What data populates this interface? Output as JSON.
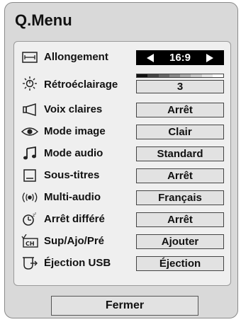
{
  "menu": {
    "title": "Q.Menu",
    "close_label": "Fermer"
  },
  "items": [
    {
      "label": "Allongement",
      "value": "16:9",
      "icon": "aspect-ratio-icon",
      "selected": true
    },
    {
      "label": "Rétroéclairage",
      "value": "3",
      "icon": "backlight-sun-icon",
      "level_fraction": 0.375
    },
    {
      "label": "Voix claires",
      "value": "Arrêt",
      "icon": "speaker-icon"
    },
    {
      "label": "Mode image",
      "value": "Clair",
      "icon": "eye-icon"
    },
    {
      "label": "Mode audio",
      "value": "Standard",
      "icon": "music-note-icon"
    },
    {
      "label": "Sous-titres",
      "value": "Arrêt",
      "icon": "subtitle-icon"
    },
    {
      "label": "Multi-audio",
      "value": "Français",
      "icon": "multi-audio-icon"
    },
    {
      "label": "Arrêt différé",
      "value": "Arrêt",
      "icon": "sleep-timer-icon"
    },
    {
      "label": "Sup/Ajo/Pré",
      "value": "Ajouter",
      "icon": "channel-ch-icon"
    },
    {
      "label": "Éjection USB",
      "value": "Éjection",
      "icon": "usb-eject-icon"
    }
  ],
  "colors": {
    "background": "#d9d9d9",
    "panel": "#efefef",
    "selected": "#000000"
  }
}
